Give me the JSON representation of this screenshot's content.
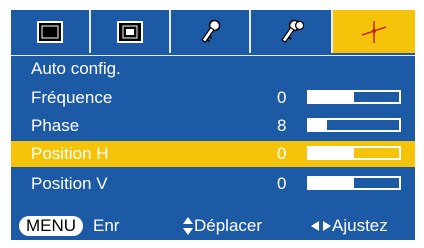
{
  "colors": {
    "menu_bg": "#1d5aa6",
    "highlight": "#f5c30a",
    "text": "#ffffff"
  },
  "tabs": [
    {
      "icon": "picture-icon",
      "selected": false
    },
    {
      "icon": "screen-icon",
      "selected": false
    },
    {
      "icon": "key-icon",
      "selected": false
    },
    {
      "icon": "keys-icon",
      "selected": false
    },
    {
      "icon": "wrench-icon",
      "selected": true
    }
  ],
  "menu": {
    "items": [
      {
        "label": "Auto config."
      },
      {
        "label": "Fréquence",
        "value": "0",
        "level": 0.5
      },
      {
        "label": "Phase",
        "value": "8",
        "level": 0.2
      },
      {
        "label": "Position H",
        "value": "0",
        "level": 0.5,
        "selected": true
      },
      {
        "label": "Position V",
        "value": "0",
        "level": 0.5
      }
    ]
  },
  "footer": {
    "menu_key": "MENU",
    "menu_action": "Enr",
    "move_action": "Déplacer",
    "adjust_action": "Ajustez"
  }
}
